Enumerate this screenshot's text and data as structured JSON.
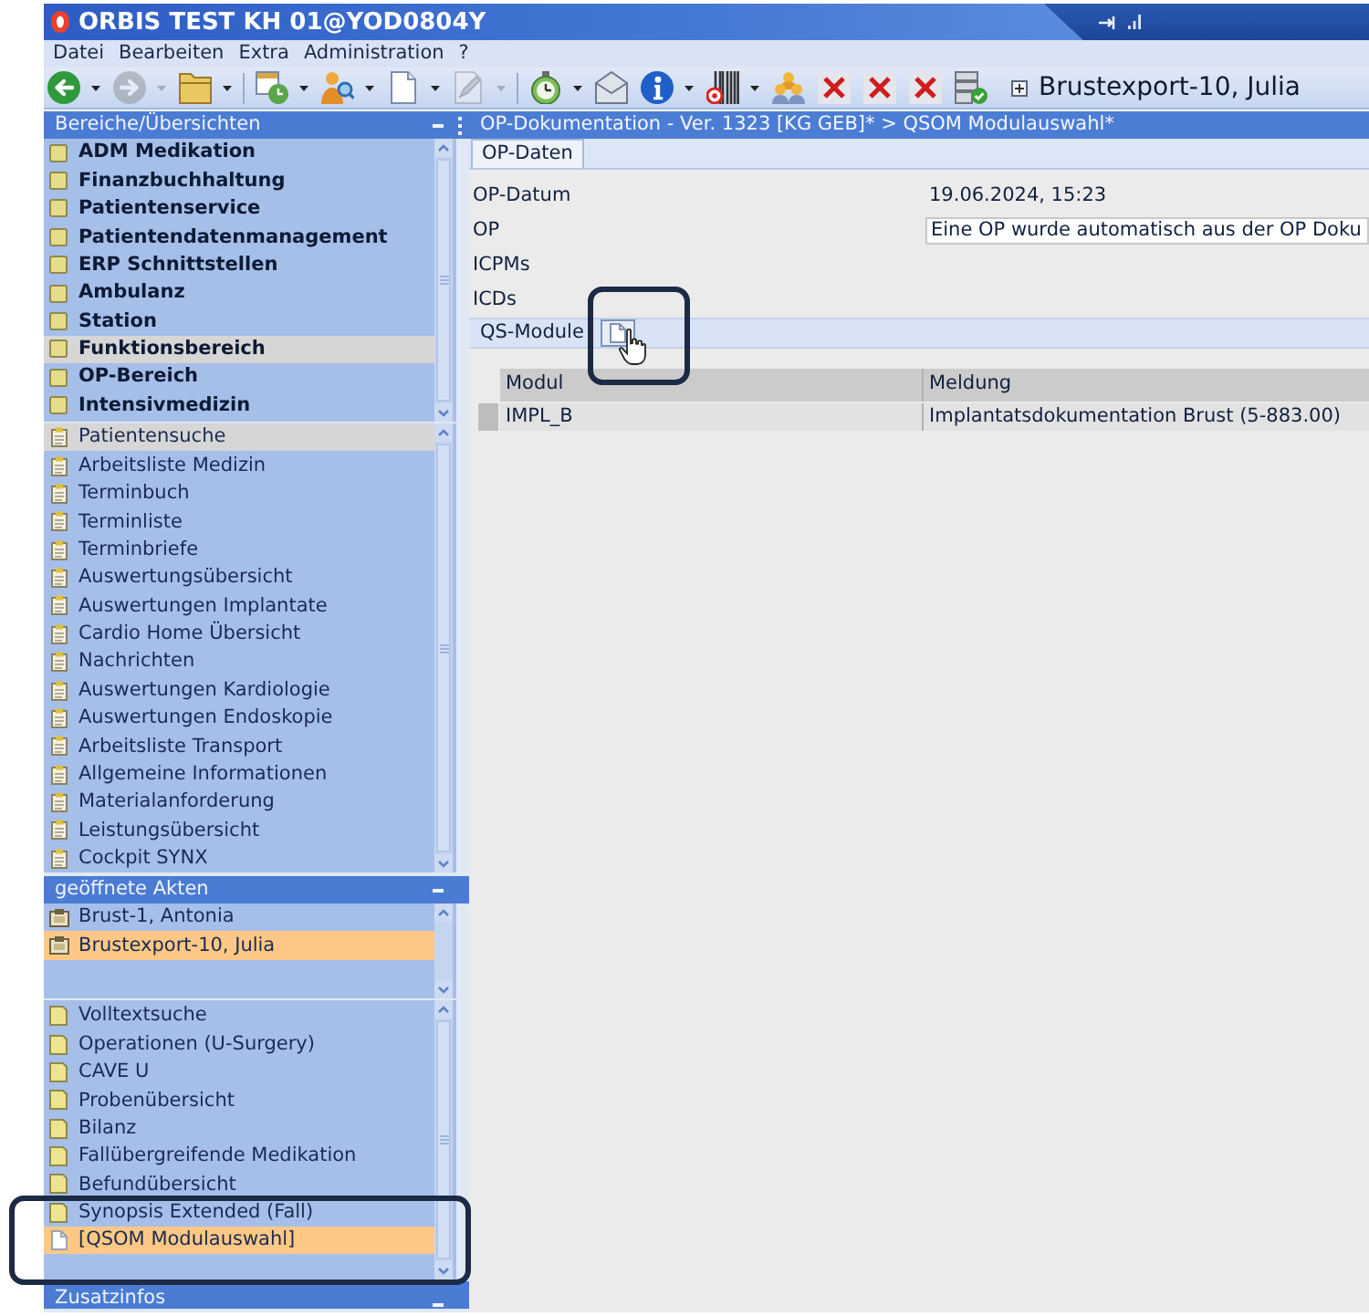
{
  "window": {
    "title": "ORBIS TEST KH 01@YOD0804Y"
  },
  "menu": [
    {
      "label": "Datei"
    },
    {
      "label": "Bearbeiten"
    },
    {
      "label": "Extra"
    },
    {
      "label": "Administration"
    },
    {
      "label": "?"
    }
  ],
  "toolbar": {
    "groups": [
      [
        {
          "disabled": false,
          "dropdown": true
        },
        {
          "disabled": true,
          "dropdown": true
        },
        {
          "disabled": false,
          "dropdown": true
        }
      ],
      [
        {
          "disabled": false,
          "dropdown": true
        },
        {
          "disabled": false,
          "dropdown": true
        },
        {
          "disabled": false,
          "dropdown": true
        },
        {
          "disabled": true,
          "dropdown": true
        }
      ],
      [
        {
          "disabled": false,
          "dropdown": true
        },
        {
          "disabled": false,
          "dropdown": false
        },
        {
          "disabled": false,
          "dropdown": true
        },
        {
          "disabled": false,
          "dropdown": true
        },
        {
          "disabled": false,
          "dropdown": false
        },
        {
          "disabled": false,
          "dropdown": false
        },
        {
          "disabled": false,
          "dropdown": false
        },
        {
          "disabled": false,
          "dropdown": false
        },
        {
          "disabled": false,
          "dropdown": false
        }
      ]
    ],
    "patient": "Brustexport-10, Julia"
  },
  "sidebar": {
    "sections": [
      {
        "title": "Bereiche/Übersichten",
        "lists": [
          {
            "active": false,
            "items": [
              {
                "label": "ADM Medikation",
                "kind": "area",
                "selected": false
              },
              {
                "label": "Finanzbuchhaltung",
                "kind": "area",
                "selected": false
              },
              {
                "label": "Patientenservice",
                "kind": "area",
                "selected": false
              },
              {
                "label": "Patientendatenmanagement",
                "kind": "area",
                "selected": false
              },
              {
                "label": "ERP Schnittstellen",
                "kind": "area",
                "selected": false
              },
              {
                "label": "Ambulanz",
                "kind": "area",
                "selected": false
              },
              {
                "label": "Station",
                "kind": "area",
                "selected": false
              },
              {
                "label": "Funktionsbereich",
                "kind": "area",
                "selected": true
              },
              {
                "label": "OP-Bereich",
                "kind": "area",
                "selected": false
              },
              {
                "label": "Intensivmedizin",
                "kind": "area",
                "selected": false
              }
            ]
          },
          {
            "active": false,
            "items": [
              {
                "label": "Patientensuche",
                "kind": "overview",
                "selected": true
              },
              {
                "label": "Arbeitsliste Medizin",
                "kind": "overview",
                "selected": false
              },
              {
                "label": "Terminbuch",
                "kind": "overview",
                "selected": false
              },
              {
                "label": "Terminliste",
                "kind": "overview",
                "selected": false
              },
              {
                "label": "Terminbriefe",
                "kind": "overview",
                "selected": false
              },
              {
                "label": "Auswertungsübersicht",
                "kind": "overview",
                "selected": false
              },
              {
                "label": "Auswertungen Implantate",
                "kind": "overview",
                "selected": false
              },
              {
                "label": "Cardio Home Übersicht",
                "kind": "overview",
                "selected": false
              },
              {
                "label": "Nachrichten",
                "kind": "overview",
                "selected": false
              },
              {
                "label": "Auswertungen Kardiologie",
                "kind": "overview",
                "selected": false
              },
              {
                "label": "Auswertungen Endoskopie",
                "kind": "overview",
                "selected": false
              },
              {
                "label": "Arbeitsliste Transport",
                "kind": "overview",
                "selected": false
              },
              {
                "label": "Allgemeine Informationen",
                "kind": "overview",
                "selected": false
              },
              {
                "label": "Materialanforderung",
                "kind": "overview",
                "selected": false
              },
              {
                "label": "Leistungsübersicht",
                "kind": "overview",
                "selected": false
              },
              {
                "label": "Cockpit SYNX",
                "kind": "overview",
                "selected": false
              }
            ]
          }
        ]
      },
      {
        "title": "geöffnete Akten",
        "lists": [
          {
            "active": true,
            "items": [
              {
                "label": "Brust-1, Antonia",
                "kind": "record",
                "selected": false
              },
              {
                "label": "Brustexport-10, Julia",
                "kind": "record",
                "selected": true
              }
            ]
          },
          {
            "active": true,
            "items": [
              {
                "label": "Volltextsuche",
                "kind": "category",
                "selected": false
              },
              {
                "label": "Operationen (U-Surgery)",
                "kind": "category",
                "selected": false
              },
              {
                "label": "CAVE U",
                "kind": "category",
                "selected": false
              },
              {
                "label": "Probenübersicht",
                "kind": "category",
                "selected": false
              },
              {
                "label": "Bilanz",
                "kind": "category",
                "selected": false
              },
              {
                "label": "Fallübergreifende Medikation",
                "kind": "category",
                "selected": false
              },
              {
                "label": "Befundübersicht",
                "kind": "category",
                "selected": false
              },
              {
                "label": "Synopsis Extended (Fall)",
                "kind": "category",
                "selected": false
              },
              {
                "label": "[QSOM Modulauswahl]",
                "kind": "document",
                "selected": true
              }
            ]
          }
        ]
      },
      {
        "title": "Zusatzinfos"
      }
    ]
  },
  "document": {
    "breadcrumb": "OP-Dokumentation - Ver. 1323 [KG GEB]* > QSOM Modulauswahl*",
    "tabs": [
      {
        "label": "OP-Daten",
        "selected": true
      }
    ],
    "fields": [
      {
        "label": "OP-Datum",
        "value": "19.06.2024, 15:23",
        "kind": "text"
      },
      {
        "label": "OP",
        "value": "Eine OP wurde automatisch aus der OP Doku",
        "kind": "input"
      },
      {
        "label": "ICPMs",
        "kind": "text"
      },
      {
        "label": "ICDs",
        "kind": "text"
      }
    ],
    "qs_modules": {
      "title": "QS-Module",
      "columns": [
        "Modul",
        "Meldung"
      ],
      "rows": [
        [
          "IMPL_B",
          "Implantatsdokumentation Brust (5-883.00)"
        ]
      ]
    }
  }
}
